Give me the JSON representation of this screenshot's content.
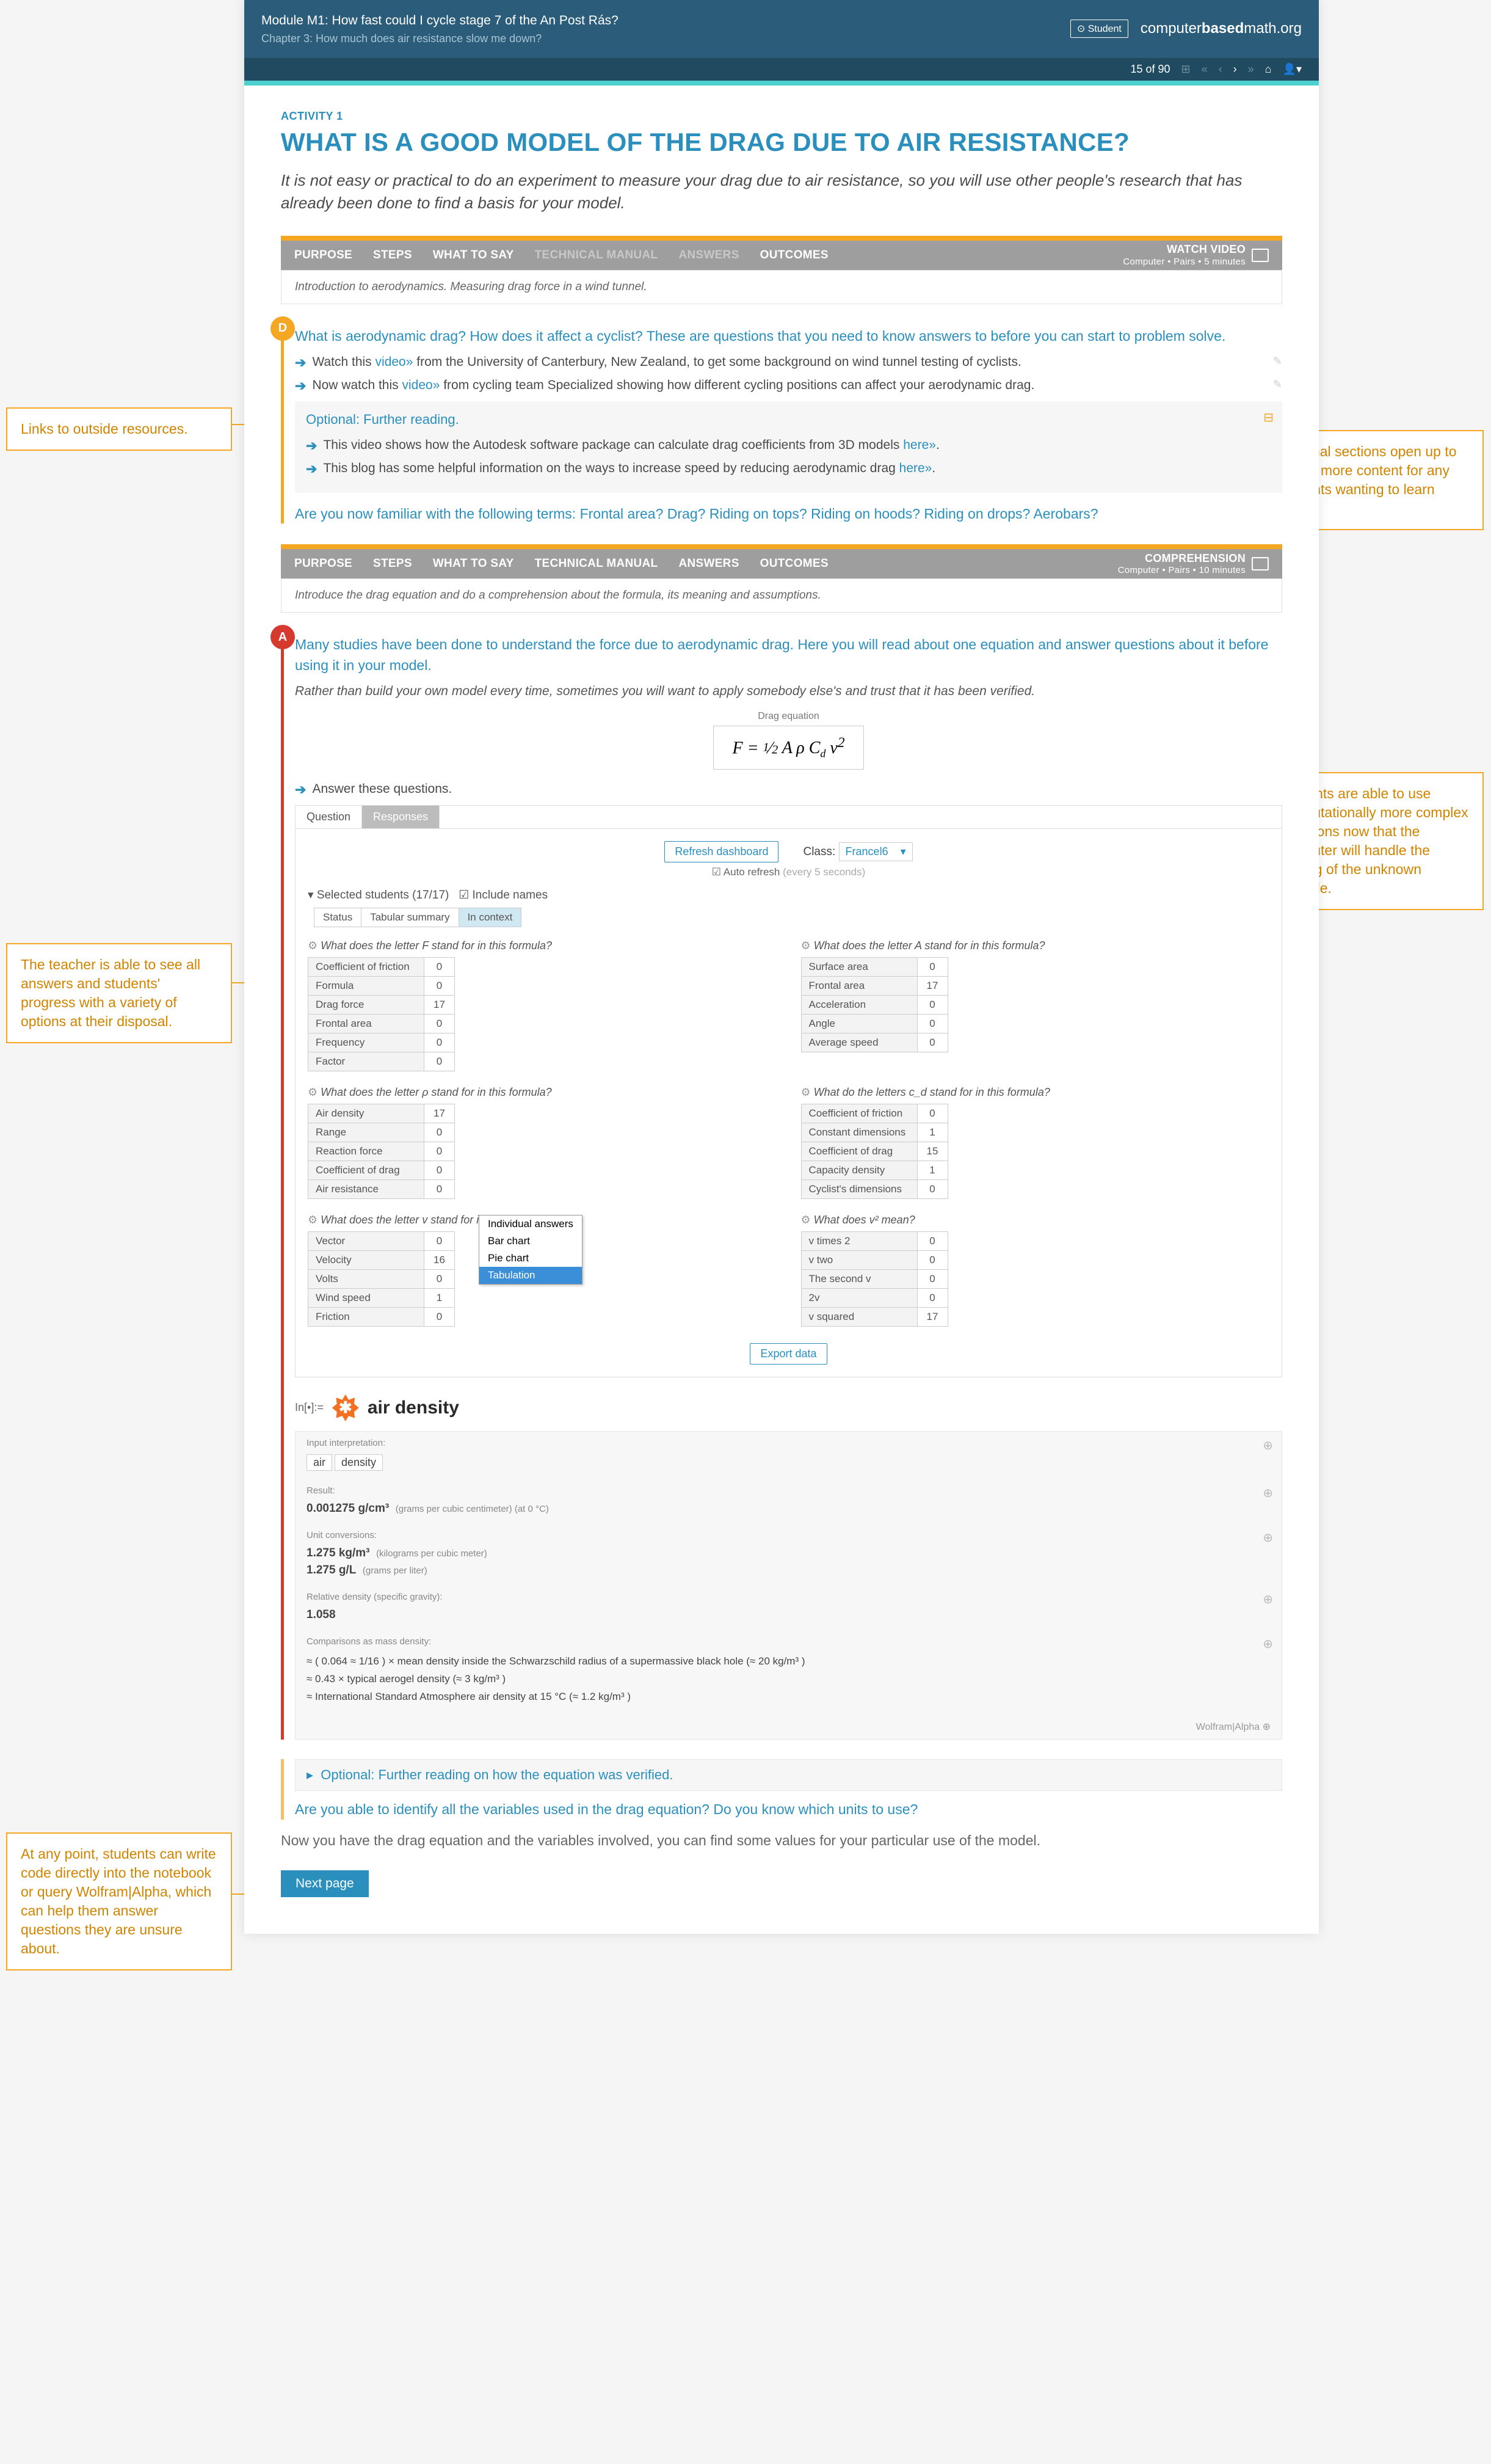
{
  "header": {
    "module": "Module M1: How fast could I cycle stage 7 of the An Post Rás?",
    "chapter": "Chapter 3: How much does air resistance slow me down?",
    "student": "⊙ Student",
    "brand_left": "computer",
    "brand_mid": "based",
    "brand_right": "math",
    "brand_tld": ".org",
    "pager": "15 of 90"
  },
  "activity": {
    "label": "ACTIVITY 1",
    "title": "WHAT IS A GOOD MODEL OF THE DRAG DUE TO AIR RESISTANCE?",
    "lead": "It is not easy or practical to do an experiment to measure your drag due to air resistance, so you will use other people's research that has already been done to find a basis for your model."
  },
  "tabs1": {
    "a": "PURPOSE",
    "b": "STEPS",
    "c": "WHAT TO SAY",
    "d": "TECHNICAL MANUAL",
    "e": "ANSWERS",
    "f": "OUTCOMES",
    "right_title": "WATCH VIDEO",
    "right_sub": "Computer • Pairs • 5 minutes",
    "desc": "Introduction to aerodynamics. Measuring drag force in a wind tunnel."
  },
  "gold": {
    "q1": "What is aerodynamic drag? How does it affect a cyclist? These are questions that you need to know answers to before you can start to problem solve.",
    "l1a": "Watch this ",
    "l1link": "video»",
    "l1b": " from the University of Canterbury, New Zealand, to get some background on wind tunnel testing of cyclists.",
    "l2a": "Now watch this ",
    "l2link": "video»",
    "l2b": " from cycling team Specialized showing how different cycling positions can affect your aerodynamic drag.",
    "opt_title": "Optional: Further reading.",
    "l3a": "This video shows how the Autodesk software package can calculate drag coefficients from 3D models ",
    "l3link": "here»",
    "l3b": ".",
    "l4a": "This blog has some helpful information on the ways to increase speed by reducing aerodynamic drag ",
    "l4link": "here»",
    "l4b": ".",
    "endq": "Are you now familiar with the following terms: Frontal area? Drag? Riding on tops? Riding on hoods? Riding on drops? Aerobars?"
  },
  "tabs2": {
    "right_title": "COMPREHENSION",
    "right_sub": "Computer • Pairs • 10 minutes",
    "desc": "Introduce the drag equation and do a comprehension about the formula, its meaning and assumptions."
  },
  "red": {
    "q1": "Many studies have been done to understand the force due to aerodynamic drag. Here you will read about one equation and answer questions about it before using it in your model.",
    "italic": "Rather than build your own model every time, sometimes you will want to apply somebody else's and trust that it has been verified.",
    "eq_label": "Drag equation",
    "eq": "F = ½ A ρ C_d v²",
    "ans_prompt": "Answer these questions.",
    "tab_q": "Question",
    "tab_r": "Responses",
    "refresh": "Refresh dashboard",
    "class_lbl": "Class:",
    "class_val": "Francel6",
    "autoref": "☑ Auto refresh",
    "autoref_sub": "(every 5 seconds)",
    "sel_students": "▾ Selected students (17/17)",
    "incnames": "☑ Include names",
    "mt1": "Status",
    "mt2": "Tabular summary",
    "mt3": "In context",
    "export": "Export data"
  },
  "questions": [
    {
      "t": "What does the letter F stand for in this formula?",
      "rows": [
        [
          "Coefficient of friction",
          "0"
        ],
        [
          "Formula",
          "0"
        ],
        [
          "Drag force",
          "17"
        ],
        [
          "Frontal area",
          "0"
        ],
        [
          "Frequency",
          "0"
        ],
        [
          "Factor",
          "0"
        ]
      ]
    },
    {
      "t": "What does the letter A stand for in this formula?",
      "rows": [
        [
          "Surface area",
          "0"
        ],
        [
          "Frontal area",
          "17"
        ],
        [
          "Acceleration",
          "0"
        ],
        [
          "Angle",
          "0"
        ],
        [
          "Average speed",
          "0"
        ]
      ]
    },
    {
      "t": "What does the letter ρ stand for in this formula?",
      "rows": [
        [
          "Air density",
          "17"
        ],
        [
          "Range",
          "0"
        ],
        [
          "Reaction force",
          "0"
        ],
        [
          "Coefficient of drag",
          "0"
        ],
        [
          "Air resistance",
          "0"
        ]
      ]
    },
    {
      "t": "What do the letters c_d stand for in this formula?",
      "rows": [
        [
          "Coefficient of friction",
          "0"
        ],
        [
          "Constant dimensions",
          "1"
        ],
        [
          "Coefficient of drag",
          "15"
        ],
        [
          "Capacity density",
          "1"
        ],
        [
          "Cyclist's dimensions",
          "0"
        ]
      ]
    },
    {
      "t": "What does the letter v stand for in this formula?",
      "rows": [
        [
          "Vector",
          "0"
        ],
        [
          "Velocity",
          "16"
        ],
        [
          "Volts",
          "0"
        ],
        [
          "Wind speed",
          "1"
        ],
        [
          "Friction",
          "0"
        ]
      ]
    },
    {
      "t": "What does v² mean?",
      "rows": [
        [
          "v times 2",
          "0"
        ],
        [
          "v two",
          "0"
        ],
        [
          "The second v",
          "0"
        ],
        [
          "2v",
          "0"
        ],
        [
          "v squared",
          "17"
        ]
      ]
    }
  ],
  "dropdown": {
    "a": "Individual answers",
    "b": "Bar chart",
    "c": "Pie chart",
    "d": "Tabulation"
  },
  "wa": {
    "pre": "In[•]:=",
    "title": "air density",
    "card1_h": "Input interpretation:",
    "tag1": "air",
    "tag2": "density",
    "card2_h": "Result:",
    "card2_v": "0.001275 g/cm³",
    "card2_s": "(grams per cubic centimeter)  (at 0 °C)",
    "card3_h": "Unit conversions:",
    "card3_a": "1.275 kg/m³",
    "card3_as": "(kilograms per cubic meter)",
    "card3_b": "1.275 g/L",
    "card3_bs": "(grams per liter)",
    "card4_h": "Relative density (specific gravity):",
    "card4_v": "1.058",
    "card5_h": "Comparisons as mass density:",
    "card5_a": "≈ ( 0.064 ≈ 1/16 ) × mean density inside the Schwarzschild radius of a supermassive black hole (≈ 20 kg/m³ )",
    "card5_b": "≈ 0.43 × typical aerogel density (≈ 3 kg/m³ )",
    "card5_c": "≈ International Standard Atmosphere air density at 15 °C (≈ 1.2 kg/m³ )",
    "foot": "Wolfram|Alpha  ⊕"
  },
  "outro": {
    "opt": "Optional: Further reading on how the equation was verified.",
    "q": "Are you able to identify all the variables used in the drag equation? Do you know which units to use?",
    "text": "Now you have the drag equation and the variables involved, you can find some values for your particular use of the model.",
    "next": "Next page"
  },
  "callouts": {
    "c1": "Links to outside resources.",
    "c2": "Optional sections open up to reveal more content for any students wanting to learn more.",
    "c3": "Students are able to use computationally more complex equations now that the computer will handle the solving of the unknown variable.",
    "c4": "The teacher is able to see all answers and students' progress with a variety of options at their disposal.",
    "c5": "At any point, students can write code directly into the notebook or query Wolfram|Alpha, which can help them answer questions they are unsure about."
  }
}
